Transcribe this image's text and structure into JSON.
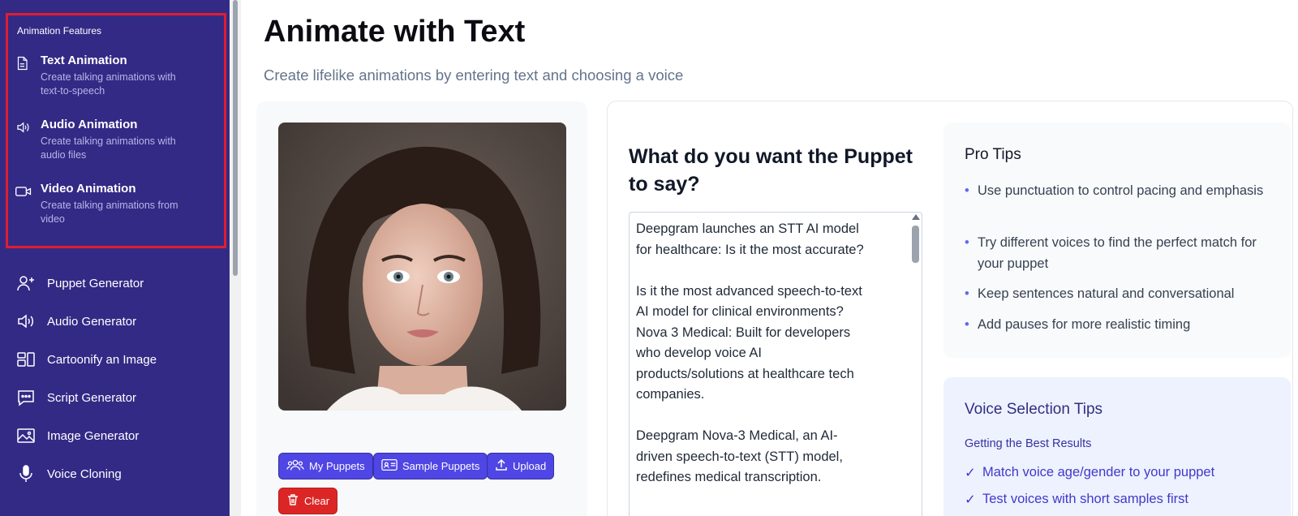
{
  "sidebar": {
    "feature_section_title": "Animation Features",
    "features": [
      {
        "icon": "document-icon",
        "name": "Text Animation",
        "desc": "Create talking animations with text-to-speech"
      },
      {
        "icon": "speaker-icon",
        "name": "Audio Animation",
        "desc": "Create talking animations with audio files"
      },
      {
        "icon": "video-camera-icon",
        "name": "Video Animation",
        "desc": "Create talking animations from video"
      }
    ],
    "nav": [
      {
        "icon": "user-plus-icon",
        "label": "Puppet Generator"
      },
      {
        "icon": "speaker-icon",
        "label": "Audio Generator"
      },
      {
        "icon": "layout-icon",
        "label": "Cartoonify an Image"
      },
      {
        "icon": "message-icon",
        "label": "Script Generator"
      },
      {
        "icon": "image-icon",
        "label": "Image Generator"
      },
      {
        "icon": "microphone-icon",
        "label": "Voice Cloning"
      }
    ]
  },
  "main": {
    "title": "Animate with Text",
    "subtitle": "Create lifelike animations by entering text and choosing a voice"
  },
  "puppet_panel": {
    "buttons": {
      "my_puppets": "My Puppets",
      "sample_puppets": "Sample Puppets",
      "upload": "Upload",
      "clear": "Clear"
    }
  },
  "script_panel": {
    "question": "What do you want the Puppet to say?",
    "script_text": "Deepgram launches an STT AI model for healthcare: Is it the most accurate?\n\nIs it the most advanced speech-to-text AI model for clinical environments? Nova 3 Medical: Built for developers who develop voice AI products/solutions at healthcare tech companies.\n\nDeepgram Nova-3 Medical, an AI-driven speech-to-text (STT) model, redefines medical transcription."
  },
  "pro_tips": {
    "title": "Pro Tips",
    "items": [
      "Use punctuation to control pacing and emphasis",
      "Try different voices to find the perfect match for your puppet",
      "Keep sentences natural and conversational",
      "Add pauses for more realistic timing"
    ]
  },
  "voice_tips": {
    "title": "Voice Selection Tips",
    "subtitle": "Getting the Best Results",
    "items": [
      "Match voice age/gender to your puppet",
      "Test voices with short samples first"
    ]
  },
  "colors": {
    "sidebar_bg": "#332a86",
    "highlight_border": "#e11d2e",
    "accent": "#4f46e5",
    "danger": "#dc2626"
  }
}
